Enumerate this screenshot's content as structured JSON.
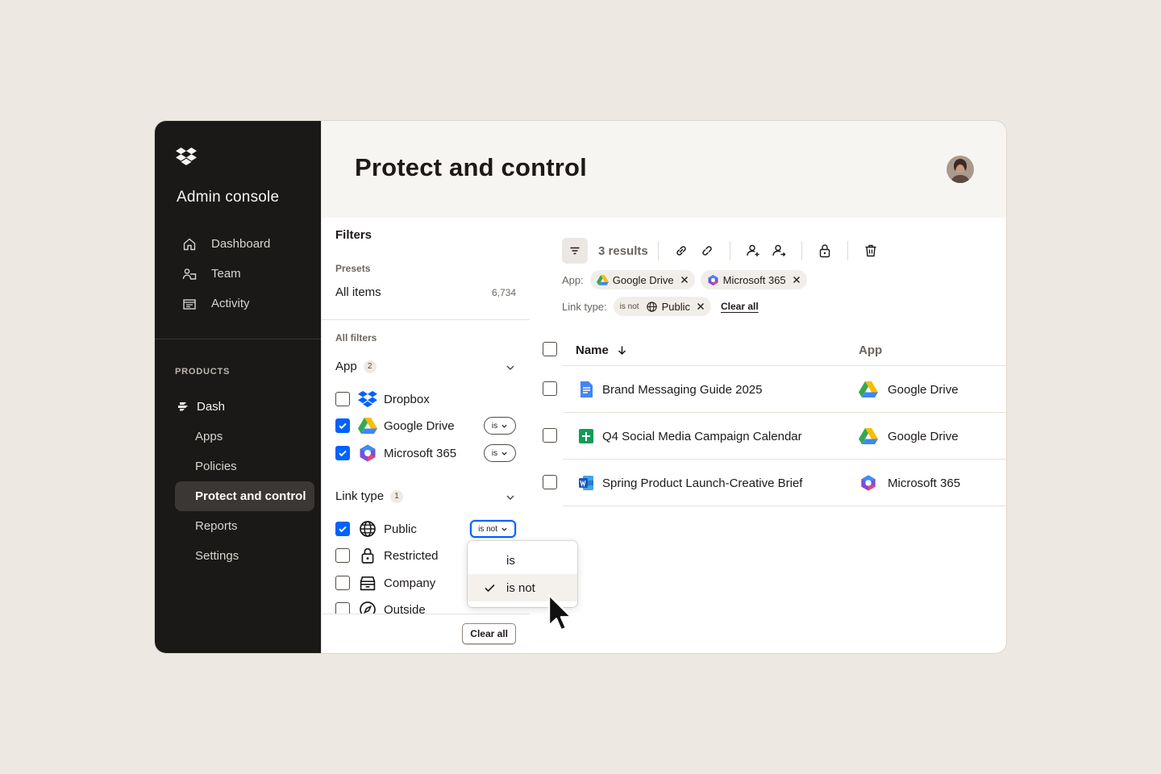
{
  "sidebar": {
    "console_title": "Admin console",
    "nav": [
      {
        "label": "Dashboard",
        "icon": "home-icon"
      },
      {
        "label": "Team",
        "icon": "team-icon"
      },
      {
        "label": "Activity",
        "icon": "activity-icon"
      }
    ],
    "products_label": "PRODUCTS",
    "dash_label": "Dash",
    "sub_nav": [
      {
        "label": "Apps"
      },
      {
        "label": "Policies"
      },
      {
        "label": "Protect and control",
        "active": true
      },
      {
        "label": "Reports"
      },
      {
        "label": "Settings"
      }
    ]
  },
  "header": {
    "title": "Protect and control"
  },
  "filters": {
    "title": "Filters",
    "presets_label": "Presets",
    "all_items_label": "All items",
    "all_items_count": "6,734",
    "all_filters_label": "All filters",
    "app_group": {
      "label": "App",
      "count": "2",
      "options": [
        {
          "label": "Dropbox",
          "checked": false
        },
        {
          "label": "Google Drive",
          "checked": true,
          "operator": "is"
        },
        {
          "label": "Microsoft 365",
          "checked": true,
          "operator": "is"
        }
      ]
    },
    "link_group": {
      "label": "Link type",
      "count": "1",
      "options": [
        {
          "label": "Public",
          "checked": true,
          "operator": "is not"
        },
        {
          "label": "Restricted",
          "checked": false
        },
        {
          "label": "Company",
          "checked": false
        },
        {
          "label": "Outside",
          "checked": false
        }
      ]
    },
    "clear_all_label": "Clear all"
  },
  "dropdown": {
    "options": [
      {
        "label": "is",
        "selected": false
      },
      {
        "label": "is not",
        "selected": true
      }
    ]
  },
  "results": {
    "count_label": "3 results",
    "app_chip_label": "App:",
    "app_chips": [
      "Google Drive",
      "Microsoft 365"
    ],
    "link_chip_label": "Link type:",
    "link_chip_operator": "is not",
    "link_chip_value": "Public",
    "clear_all_label": "Clear all",
    "columns": {
      "name": "Name",
      "app": "App"
    },
    "rows": [
      {
        "name": "Brand Messaging Guide 2025",
        "file_icon": "google-docs-icon",
        "app": "Google Drive"
      },
      {
        "name": "Q4 Social Media Campaign Calendar",
        "file_icon": "google-sheets-icon",
        "app": "Google Drive"
      },
      {
        "name": "Spring Product Launch-Creative Brief",
        "file_icon": "word-doc-icon",
        "app": "Microsoft 365"
      }
    ]
  },
  "colors": {
    "accent": "#0061fe",
    "sidebar_bg": "#1a1918",
    "page_bg": "#ede8e1"
  }
}
